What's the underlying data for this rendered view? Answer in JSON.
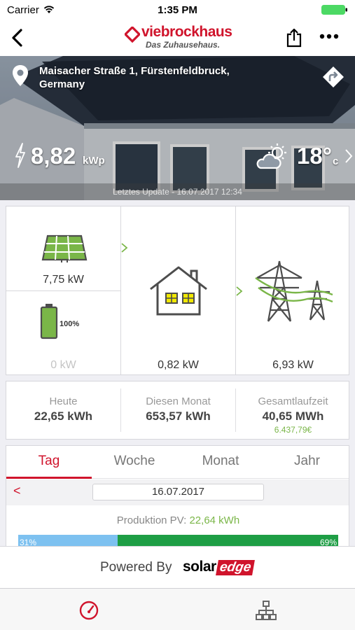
{
  "status_bar": {
    "carrier": "Carrier",
    "time": "1:35 PM"
  },
  "brand": {
    "name": "viebrockhaus",
    "tagline": "Das Zuhausehaus.",
    "color": "#d0142c"
  },
  "hero": {
    "address": "Maisacher Straße 1, Fürstenfeldbruck, Germany",
    "peak_power": "8,82",
    "peak_unit": "kWp",
    "temperature": "18°",
    "temp_unit": "c",
    "last_update": "Letztes Update - 16.07.2017 12:34"
  },
  "flow": {
    "pv_value": "7,75 kW",
    "battery_percent": "100%",
    "battery_value": "0 kW",
    "home_value": "0,82 kW",
    "grid_value": "6,93 kW"
  },
  "stats": {
    "today_label": "Heute",
    "today_value": "22,65 kWh",
    "month_label": "Diesen Monat",
    "month_value": "653,57 kWh",
    "total_label": "Gesamtlaufzeit",
    "total_value": "40,65 MWh",
    "total_money": "6.437,79€"
  },
  "tabs": {
    "day": "Tag",
    "week": "Woche",
    "month": "Monat",
    "year": "Jahr"
  },
  "date_nav": {
    "prev": "<",
    "date": "16.07.2017"
  },
  "production": {
    "label": "Produktion PV:",
    "value": "22,64 kWh",
    "left_pct": "31%",
    "right_pct": "69%",
    "left_fraction": 0.31
  },
  "powered": {
    "prefix": "Powered By",
    "brand_a": "solar",
    "brand_b": "edge"
  },
  "colors": {
    "accent": "#d0142c",
    "green": "#7ab648",
    "bar_blue": "#7dc1f0",
    "bar_green": "#1e9e45"
  }
}
